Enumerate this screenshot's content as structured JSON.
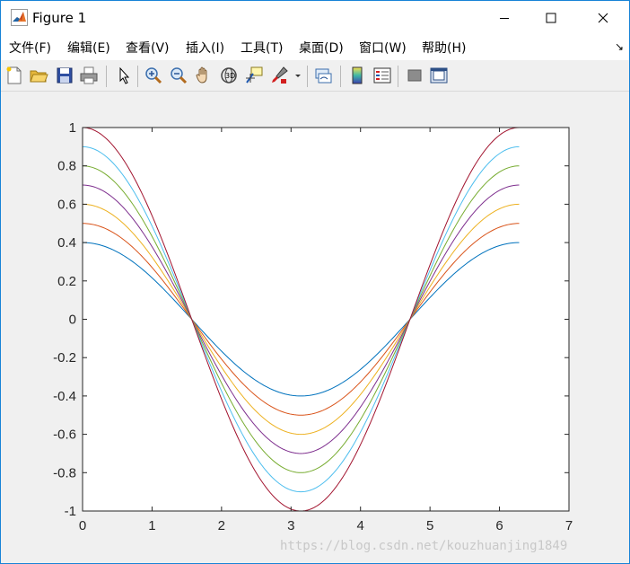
{
  "window": {
    "title": "Figure 1",
    "minimize_icon": "minimize-icon",
    "maximize_icon": "maximize-icon",
    "close_icon": "close-icon"
  },
  "menu": [
    {
      "label": "文件(F)"
    },
    {
      "label": "编辑(E)"
    },
    {
      "label": "查看(V)"
    },
    {
      "label": "插入(I)"
    },
    {
      "label": "工具(T)"
    },
    {
      "label": "桌面(D)"
    },
    {
      "label": "窗口(W)"
    },
    {
      "label": "帮助(H)"
    }
  ],
  "toolbar": [
    "new-figure-icon",
    "open-file-icon",
    "save-icon",
    "print-icon",
    "edit-plot-arrow-icon",
    "zoom-in-icon",
    "zoom-out-icon",
    "pan-hand-icon",
    "rotate-3d-icon",
    "data-cursor-icon",
    "brush-icon",
    "brush-dropdown-icon",
    "link-plot-icon",
    "insert-colorbar-icon",
    "insert-legend-icon",
    "hide-plot-tools-icon",
    "show-plot-tools-icon"
  ],
  "watermark": "https://blog.csdn.net/kouzhuanjing1849",
  "chart_data": {
    "type": "line",
    "title": "",
    "xlabel": "",
    "ylabel": "",
    "xlim": [
      0,
      7
    ],
    "ylim": [
      -1,
      1
    ],
    "xticks": [
      "0",
      "1",
      "2",
      "3",
      "4",
      "5",
      "6",
      "7"
    ],
    "yticks": [
      "-1",
      "-0.8",
      "-0.6",
      "-0.4",
      "-0.2",
      "0",
      "0.2",
      "0.4",
      "0.6",
      "0.8",
      "1"
    ],
    "grid": false,
    "x_range": [
      0,
      6.2832
    ],
    "function": "y = a * cos(x)",
    "series": [
      {
        "amplitude": 0.4,
        "color": "#0072bd"
      },
      {
        "amplitude": 0.5,
        "color": "#d95319"
      },
      {
        "amplitude": 0.6,
        "color": "#edb120"
      },
      {
        "amplitude": 0.7,
        "color": "#7e2f8e"
      },
      {
        "amplitude": 0.8,
        "color": "#77ac30"
      },
      {
        "amplitude": 0.9,
        "color": "#4dbeee"
      },
      {
        "amplitude": 1.0,
        "color": "#a2142f"
      }
    ]
  }
}
